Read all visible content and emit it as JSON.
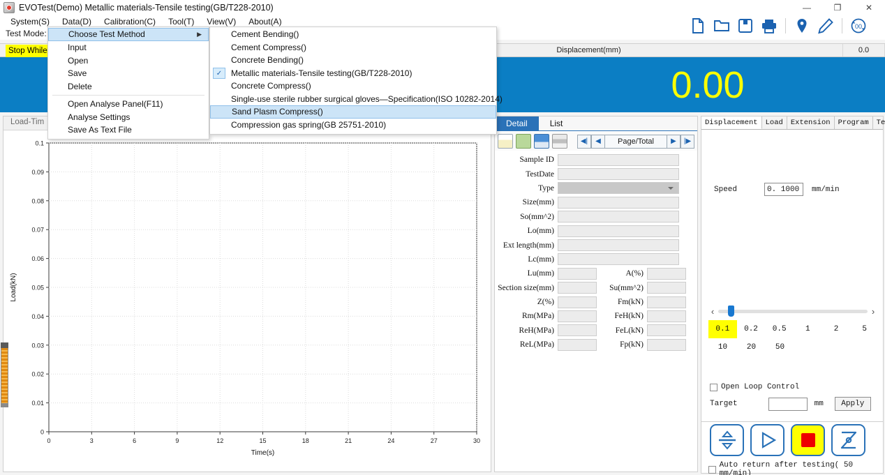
{
  "window": {
    "title": "EVOTest(Demo) Metallic materials-Tensile testing(GB/T228-2010)",
    "app_icon": "app-icon",
    "minimize": "—",
    "maximize": "❐",
    "close": "✕"
  },
  "menubar": {
    "items": [
      {
        "label": "System(S)"
      },
      {
        "label": "Data(D)"
      },
      {
        "label": "Calibration(C)"
      },
      {
        "label": "Tool(T)"
      },
      {
        "label": "View(V)"
      },
      {
        "label": "About(A)"
      }
    ]
  },
  "testmode": {
    "label": "Test Mode:"
  },
  "data_menu": {
    "items": [
      {
        "label": "Choose Test Method",
        "submenu": true,
        "highlight": true,
        "arrow": "▶"
      },
      {
        "label": "Input"
      },
      {
        "label": "Open"
      },
      {
        "label": "Save"
      },
      {
        "label": "Delete"
      },
      {
        "separator": true
      },
      {
        "label": "Open Analyse Panel(F11)"
      },
      {
        "label": "Analyse Settings"
      },
      {
        "label": "Save As Text File"
      }
    ]
  },
  "method_menu": {
    "items": [
      {
        "label": "Cement Bending()"
      },
      {
        "label": "Cement Compress()"
      },
      {
        "label": "Concrete Bending()"
      },
      {
        "label": "Metallic materials-Tensile testing(GB/T228-2010)",
        "checked": true,
        "check_glyph": "✓"
      },
      {
        "label": "Concrete Compress()"
      },
      {
        "label": "Single-use sterile rubber surgical gloves—Specification(ISO 10282-2014)"
      },
      {
        "label": "Sand Plasm Compress()",
        "highlight": true
      },
      {
        "label": "Compression gas spring(GB 25751-2010)"
      }
    ]
  },
  "toolbar": {
    "icons": [
      {
        "name": "new-file-icon"
      },
      {
        "name": "open-folder-icon"
      },
      {
        "name": "save-icon"
      },
      {
        "name": "print-icon"
      },
      {
        "name": "location-pin-icon"
      },
      {
        "name": "pencil-icon"
      },
      {
        "name": "zero-reset-icon"
      }
    ]
  },
  "readout": {
    "stop_while": "Stop While D",
    "load_value": "0.00",
    "displacement_label": "Displacement(mm)",
    "displacement_value": "0.00",
    "small_value_1": "0.0",
    "small_value_2": "0.0"
  },
  "chart_panel": {
    "tab_label": "Load-Tim"
  },
  "chart_data": {
    "type": "line",
    "title": "",
    "xlabel": "Time(s)",
    "ylabel": "Load(kN)",
    "xlim": [
      0,
      30
    ],
    "ylim": [
      0,
      0.1
    ],
    "xticks": [
      0,
      3,
      6,
      9,
      12,
      15,
      18,
      21,
      24,
      27,
      30
    ],
    "xticklabels": [
      "0",
      "3",
      "6",
      "9",
      "12",
      "15",
      "18",
      "21",
      "24",
      "27",
      "30"
    ],
    "yticks": [
      0,
      0.01,
      0.02,
      0.03,
      0.04,
      0.05,
      0.06,
      0.07,
      0.08,
      0.09,
      0.1
    ],
    "yticklabels": [
      "0",
      "0.01",
      "0.02",
      "0.03",
      "0.04",
      "0.05",
      "0.06",
      "0.07",
      "0.08",
      "0.09",
      "0.1"
    ],
    "grid": true,
    "legend": null,
    "series": [
      {
        "name": "Load-Time",
        "x": [],
        "y": []
      }
    ]
  },
  "detail": {
    "tabs": [
      {
        "label": "Detail",
        "selected": true
      },
      {
        "label": "List",
        "selected": false
      }
    ],
    "toolbar": [
      {
        "name": "new-record-icon"
      },
      {
        "name": "open-record-icon"
      },
      {
        "name": "save-record-icon"
      },
      {
        "name": "print-record-icon"
      }
    ],
    "pager": {
      "first": "◀|",
      "prev": "◀",
      "page_total": "Page/Total",
      "next": "▶",
      "last": "|▶"
    },
    "fields": [
      {
        "label": "Sample ID",
        "value": "",
        "kind": "wide"
      },
      {
        "label": "TestDate",
        "value": "",
        "kind": "wide"
      },
      {
        "label": "Type",
        "value": "",
        "kind": "select"
      },
      {
        "label": "Size(mm)",
        "value": "",
        "kind": "wide"
      },
      {
        "label": "So(mm^2)",
        "value": "",
        "kind": "wide"
      },
      {
        "label": "Lo(mm)",
        "value": "",
        "kind": "wide"
      },
      {
        "label": "Ext length(mm)",
        "value": "",
        "kind": "wide"
      },
      {
        "label": "Lc(mm)",
        "value": "",
        "kind": "wide"
      }
    ],
    "field_pairs": [
      {
        "label_left": "Lu(mm)",
        "value_left": "",
        "label_right": "A(%)",
        "value_right": ""
      },
      {
        "label_left": "Section size(mm)",
        "value_left": "",
        "label_right": "Su(mm^2)",
        "value_right": ""
      },
      {
        "label_left": "Z(%)",
        "value_left": "",
        "label_right": "Fm(kN)",
        "value_right": ""
      },
      {
        "label_left": "Rm(MPa)",
        "value_left": "",
        "label_right": "FeH(kN)",
        "value_right": ""
      },
      {
        "label_left": "ReH(MPa)",
        "value_left": "",
        "label_right": "FeL(kN)",
        "value_right": ""
      },
      {
        "label_left": "ReL(MPa)",
        "value_left": "",
        "label_right": "Fp(kN)",
        "value_right": ""
      }
    ]
  },
  "control": {
    "tabs": [
      {
        "label": "Displacement",
        "selected": true
      },
      {
        "label": "Load",
        "selected": false
      },
      {
        "label": "Extension",
        "selected": false
      },
      {
        "label": "Program",
        "selected": false
      },
      {
        "label": "Ten",
        "selected": false
      }
    ],
    "tab_scroll_left": "◀",
    "tab_scroll_right": "▶",
    "speed_label": "Speed",
    "speed_value": "0. 1000",
    "speed_unit": "mm/min",
    "slider_left": "‹",
    "slider_right": "›",
    "speed_presets_row1": [
      {
        "label": "0.1",
        "selected": true
      },
      {
        "label": "0.2",
        "selected": false
      },
      {
        "label": "0.5",
        "selected": false
      },
      {
        "label": "1",
        "selected": false
      },
      {
        "label": "2",
        "selected": false
      },
      {
        "label": "5",
        "selected": false
      }
    ],
    "speed_presets_row2": [
      {
        "label": "10",
        "selected": false
      },
      {
        "label": "20",
        "selected": false
      },
      {
        "label": "50",
        "selected": false
      }
    ],
    "open_loop_label": "Open Loop Control",
    "target_label": "Target",
    "target_value": "",
    "target_unit": "mm",
    "apply_label": "Apply"
  },
  "actions": {
    "buttons": [
      {
        "name": "jog-up-down-button"
      },
      {
        "name": "start-button"
      },
      {
        "name": "stop-button",
        "highlighted": true
      },
      {
        "name": "return-button"
      }
    ],
    "auto_return_label": "Auto return after testing( 50   mm/min)"
  },
  "colors": {
    "accent_blue": "#0b7ec4",
    "highlight_yellow": "#ffff00",
    "menu_highlight": "#cce4f7",
    "stop_red": "#ee0000",
    "icon_blue": "#1b62b0"
  }
}
